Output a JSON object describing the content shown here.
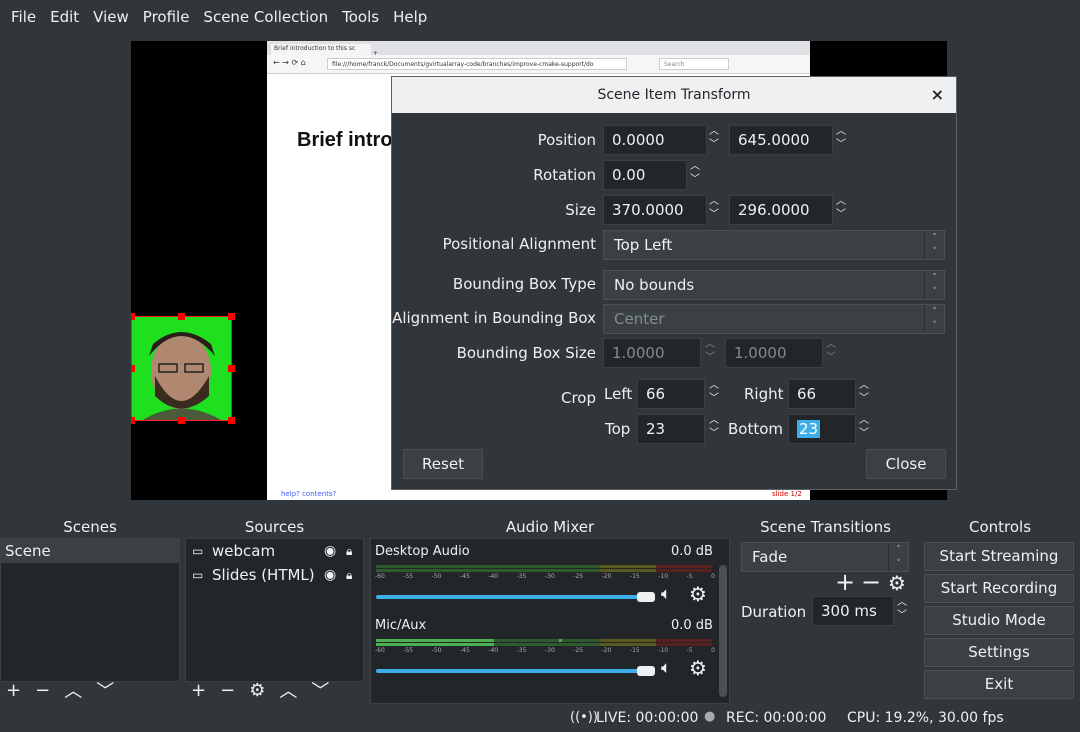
{
  "menu": {
    "items": [
      {
        "label": "File"
      },
      {
        "label": "Edit"
      },
      {
        "label": "View"
      },
      {
        "label": "Profile"
      },
      {
        "label": "Scene Collection"
      },
      {
        "label": "Tools"
      },
      {
        "label": "Help"
      }
    ]
  },
  "preview": {
    "browser_tab": "Brief introduction to this sc",
    "browser_url": "file:///home/franck/Documents/gvirtualarray-code/branches/improve-cmake-support/do",
    "browser_search": "Search",
    "slide_heading": "Brief intro",
    "slide_footer_left": "help? contents?",
    "slide_footer_right": "slide 1/2"
  },
  "dialog": {
    "title": "Scene Item Transform",
    "close_icon": "×",
    "position_label": "Position",
    "position_x": "0.0000",
    "position_y": "645.0000",
    "rotation_label": "Rotation",
    "rotation": "0.00",
    "size_label": "Size",
    "size_w": "370.0000",
    "size_h": "296.0000",
    "positional_alignment_label": "Positional Alignment",
    "positional_alignment": "Top Left",
    "bbox_type_label": "Bounding Box Type",
    "bbox_type": "No bounds",
    "bbox_align_label": "Alignment in Bounding Box",
    "bbox_align": "Center",
    "bbox_size_label": "Bounding Box Size",
    "bbox_w": "1.0000",
    "bbox_h": "1.0000",
    "crop_label": "Crop",
    "crop_left_label": "Left",
    "crop_left": "66",
    "crop_right_label": "Right",
    "crop_right": "66",
    "crop_top_label": "Top",
    "crop_top": "23",
    "crop_bottom_label": "Bottom",
    "crop_bottom": "23",
    "reset_label": "Reset",
    "close_label": "Close"
  },
  "scenes": {
    "title": "Scenes",
    "items": [
      {
        "label": "Scene"
      }
    ]
  },
  "sources": {
    "title": "Sources",
    "items": [
      {
        "label": "webcam"
      },
      {
        "label": "Slides (HTML)"
      }
    ]
  },
  "mixer": {
    "title": "Audio Mixer",
    "channels": [
      {
        "name": "Desktop Audio",
        "db": "0.0 dB",
        "level": 0.0
      },
      {
        "name": "Mic/Aux",
        "db": "0.0 dB",
        "level": 0.33
      }
    ],
    "scale": [
      "-60",
      "-55",
      "-50",
      "-45",
      "-40",
      "-35",
      "-30",
      "-25",
      "-20",
      "-15",
      "-10",
      "-5",
      "0"
    ]
  },
  "transitions": {
    "title": "Scene Transitions",
    "selected": "Fade",
    "duration_label": "Duration",
    "duration": "300 ms"
  },
  "controls": {
    "title": "Controls",
    "start_streaming": "Start Streaming",
    "start_recording": "Start Recording",
    "studio_mode": "Studio Mode",
    "settings": "Settings",
    "exit": "Exit"
  },
  "status": {
    "live": "LIVE: 00:00:00",
    "rec": "REC: 00:00:00",
    "cpu": "CPU: 19.2%, 30.00 fps"
  },
  "colors": {
    "window_bg": "#31363b",
    "accent": "#3daee9",
    "meter_green": "#4caf50",
    "meter_yellow": "#b0a030",
    "meter_red": "#a03030"
  }
}
